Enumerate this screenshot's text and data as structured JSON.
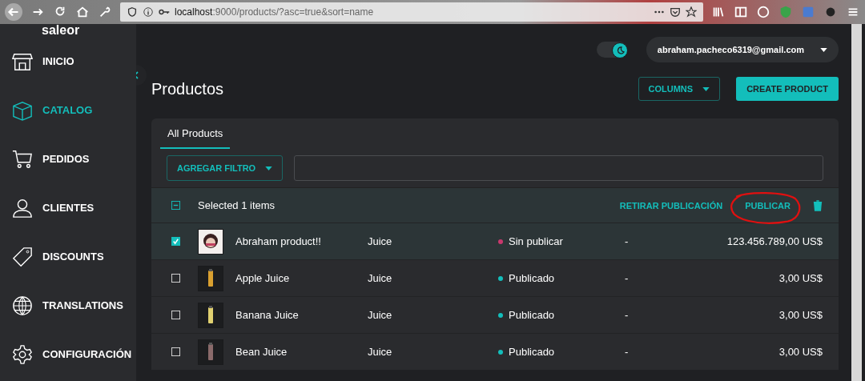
{
  "browser": {
    "url_host": "localhost",
    "url_rest": ":9000/products/?asc=true&sort=name"
  },
  "sidebar": {
    "logo": "saleor",
    "items": [
      {
        "label": "INICIO",
        "selected": false
      },
      {
        "label": "CATALOG",
        "selected": true
      },
      {
        "label": "PEDIDOS",
        "selected": false
      },
      {
        "label": "CLIENTES",
        "selected": false
      },
      {
        "label": "DISCOUNTS",
        "selected": false
      },
      {
        "label": "TRANSLATIONS",
        "selected": false
      },
      {
        "label": "CONFIGURACIÓN",
        "selected": false
      }
    ]
  },
  "header": {
    "dark_mode": {
      "on": true
    },
    "user_email": "abraham.pacheco6319@gmail.com"
  },
  "page": {
    "title": "Productos",
    "columns_button": "COLUMNS",
    "create_button": "CREATE PRODUCT"
  },
  "tabs": [
    {
      "label": "All Products",
      "selected": true
    }
  ],
  "filter": {
    "button": "AGREGAR FILTRO"
  },
  "bulk_bar": {
    "indeterminate": true,
    "text": "Selected 1 items",
    "unpublish": "RETIRAR PUBLICACIÓN",
    "publish": "PUBLICAR"
  },
  "rows": [
    {
      "name": "Abraham product!!",
      "type": "Juice",
      "status": "Sin publicar",
      "color": "#c9386d",
      "availability": "-",
      "price": "123.456.789,00 US$",
      "selected": true
    },
    {
      "name": "Apple Juice",
      "type": "Juice",
      "status": "Publicado",
      "color": "#13bebb",
      "availability": "-",
      "price": "3,00 US$",
      "selected": false
    },
    {
      "name": "Banana Juice",
      "type": "Juice",
      "status": "Publicado",
      "color": "#13bebb",
      "availability": "-",
      "price": "3,00 US$",
      "selected": false
    },
    {
      "name": "Bean Juice",
      "type": "Juice",
      "status": "Publicado",
      "color": "#13bebb",
      "availability": "-",
      "price": "3,00 US$",
      "selected": false
    }
  ]
}
